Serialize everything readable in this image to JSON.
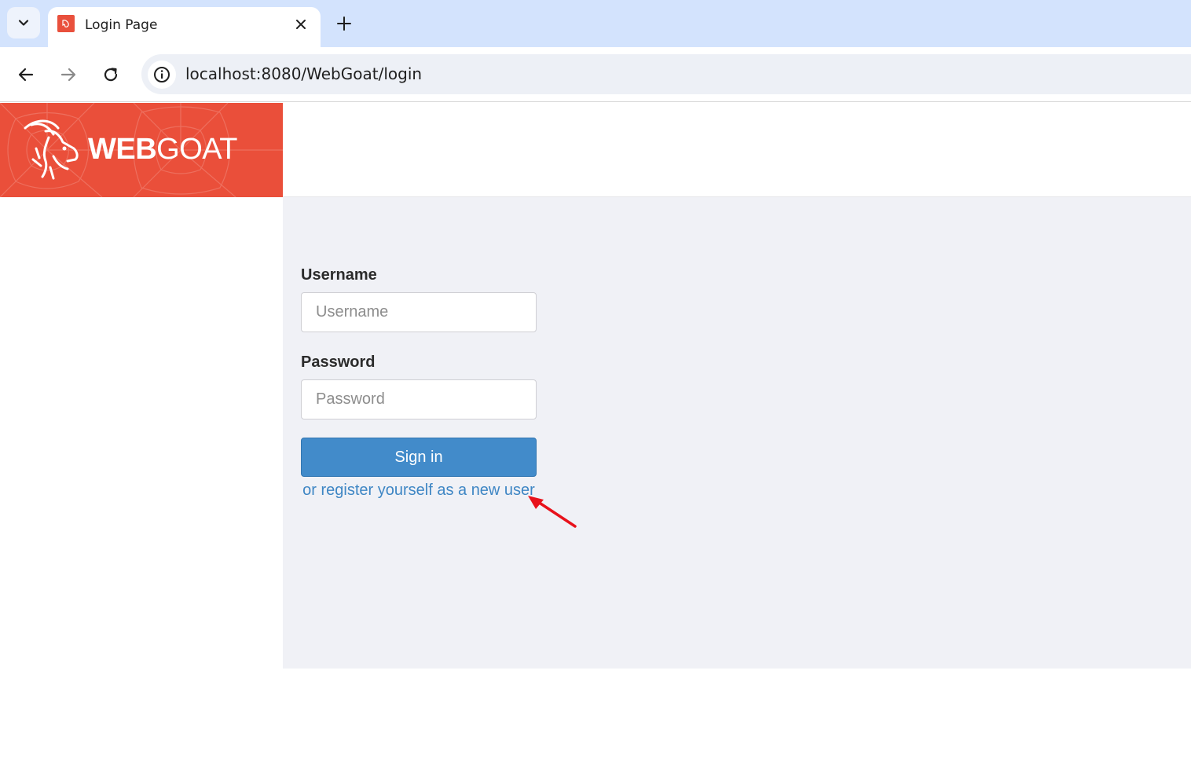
{
  "browser": {
    "tab": {
      "title": "Login Page"
    },
    "address_bar": {
      "url": "localhost:8080/WebGoat/login"
    },
    "icons": [
      "tab-search-icon",
      "close-icon",
      "plus-icon",
      "back-arrow-icon",
      "forward-arrow-icon",
      "reload-icon",
      "info-icon"
    ]
  },
  "brand": {
    "name_bold": "WEB",
    "name_light": "GOAT",
    "colors": {
      "primary": "#ea4f3a"
    }
  },
  "login": {
    "username_label": "Username",
    "username_placeholder": "Username",
    "password_label": "Password",
    "password_placeholder": "Password",
    "signin_label": "Sign in",
    "register_link": "or register yourself as a new user"
  },
  "colors": {
    "button": "#428bca",
    "link": "#3e86c4",
    "annotation_arrow": "#e8121b",
    "content_bg": "#f0f1f6"
  }
}
